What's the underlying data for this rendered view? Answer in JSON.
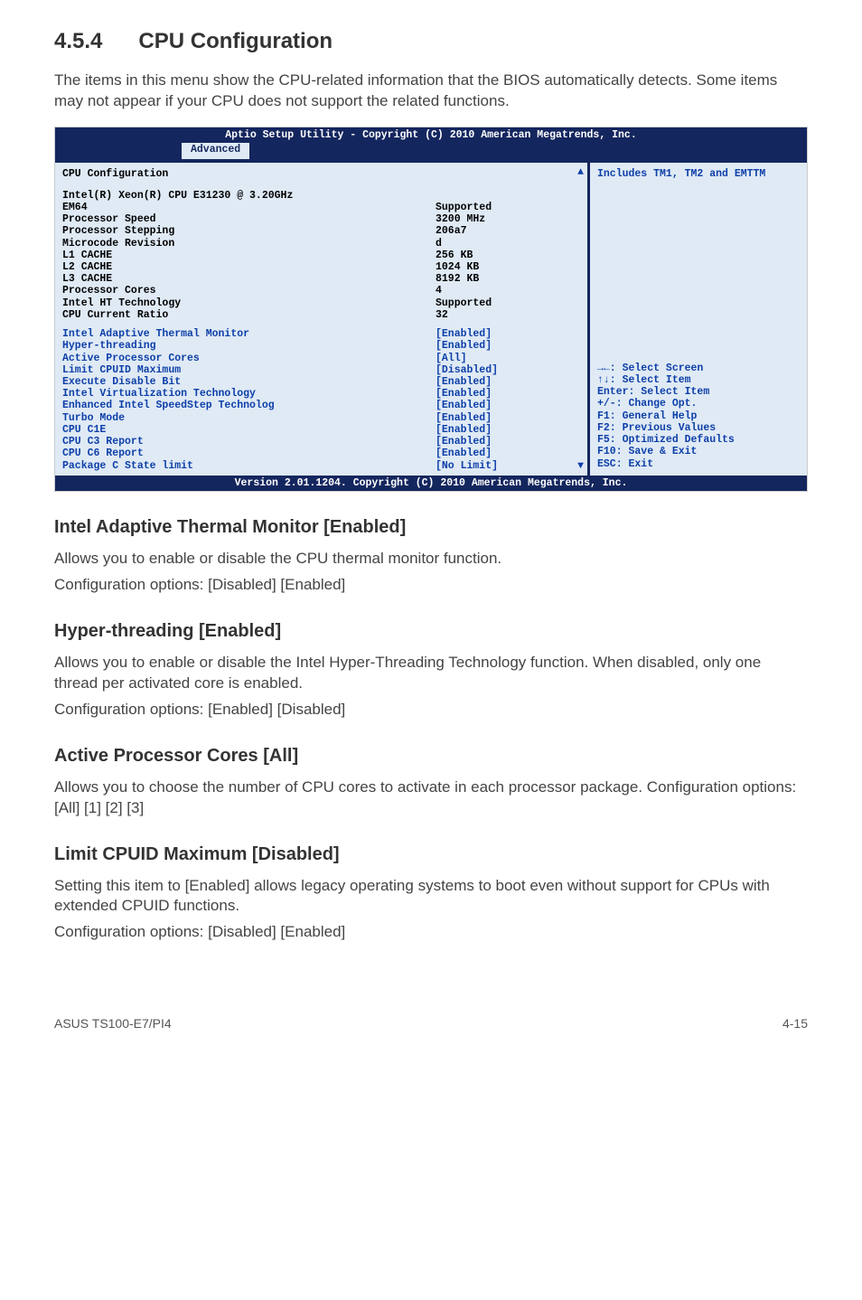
{
  "heading": {
    "num": "4.5.4",
    "title": "CPU Configuration"
  },
  "intro": "The items in this menu show the CPU-related information that the BIOS automatically detects. Some items may not appear if your CPU does not support the related functions.",
  "bios": {
    "header": "Aptio Setup Utility - Copyright (C) 2010 American Megatrends, Inc.",
    "tab": "Advanced",
    "left_title": "CPU Configuration",
    "static_rows": [
      {
        "label": "Intel(R) Xeon(R) CPU E31230 @ 3.20GHz",
        "value": ""
      },
      {
        "label": "EM64",
        "value": "Supported"
      },
      {
        "label": "Processor Speed",
        "value": "3200 MHz"
      },
      {
        "label": "Processor Stepping",
        "value": "206a7"
      },
      {
        "label": "Microcode Revision",
        "value": "d"
      },
      {
        "label": "L1 CACHE",
        "value": "256 KB"
      },
      {
        "label": "L2 CACHE",
        "value": "1024 KB"
      },
      {
        "label": "L3 CACHE",
        "value": "8192 KB"
      },
      {
        "label": "Processor Cores",
        "value": "4"
      },
      {
        "label": "Intel HT Technology",
        "value": "Supported"
      },
      {
        "label": "CPU Current Ratio",
        "value": "32"
      }
    ],
    "cfg_rows": [
      {
        "label": "Intel Adaptive Thermal Monitor",
        "value": "[Enabled]"
      },
      {
        "label": "Hyper-threading",
        "value": "[Enabled]"
      },
      {
        "label": "Active Processor Cores",
        "value": "[All]"
      },
      {
        "label": "Limit CPUID Maximum",
        "value": "[Disabled]"
      },
      {
        "label": "Execute Disable Bit",
        "value": "[Enabled]"
      },
      {
        "label": "Intel Virtualization Technology",
        "value": "[Enabled]"
      },
      {
        "label": "Enhanced Intel SpeedStep Technolog",
        "value": "[Enabled]"
      },
      {
        "label": "Turbo Mode",
        "value": "[Enabled]"
      },
      {
        "label": "CPU C1E",
        "value": "[Enabled]"
      },
      {
        "label": "CPU C3 Report",
        "value": "[Enabled]"
      },
      {
        "label": "CPU C6 Report",
        "value": "[Enabled]"
      },
      {
        "label": "Package C State limit",
        "value": "[No Limit]"
      }
    ],
    "help_top": "Includes TM1, TM2 and EMTTM",
    "help_keys": [
      "→←: Select Screen",
      "↑↓:  Select Item",
      "Enter: Select Item",
      "+/-: Change Opt.",
      "F1: General Help",
      "F2: Previous Values",
      "F5: Optimized Defaults",
      "F10: Save & Exit",
      "ESC: Exit"
    ],
    "footer": "Version 2.01.1204. Copyright (C) 2010 American Megatrends, Inc."
  },
  "sections": [
    {
      "h": "Intel Adaptive Thermal Monitor [Enabled]",
      "p1": "Allows you to enable or disable the CPU thermal monitor function.",
      "p2": "Configuration options: [Disabled] [Enabled]"
    },
    {
      "h": "Hyper-threading [Enabled]",
      "p1": "Allows you to enable or disable the Intel Hyper-Threading Technology function. When disabled, only one thread per activated core is enabled.",
      "p2": "Configuration options: [Enabled] [Disabled]"
    },
    {
      "h": "Active Processor Cores [All]",
      "p1": "Allows you to choose the number of CPU cores to activate in each processor package. Configuration options: [All] [1] [2] [3]",
      "p2": ""
    },
    {
      "h": "Limit CPUID Maximum [Disabled]",
      "p1": "Setting this item to [Enabled] allows legacy operating systems to boot even without support for CPUs with extended CPUID functions.",
      "p2": "Configuration options: [Disabled] [Enabled]"
    }
  ],
  "footer": {
    "left": "ASUS TS100-E7/PI4",
    "right": "4-15"
  }
}
